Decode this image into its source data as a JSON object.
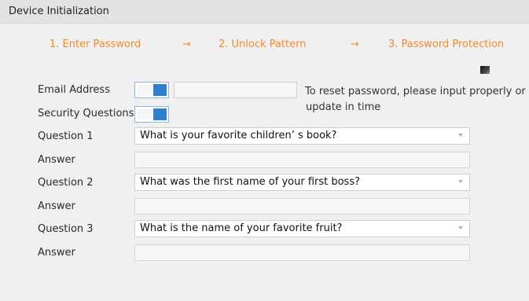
{
  "window": {
    "title": "Device Initialization"
  },
  "steps": [
    {
      "label": "1.  Enter Password"
    },
    {
      "label": "2.  Unlock Pattern"
    },
    {
      "label": "3.  Password Protection"
    }
  ],
  "step_arrow": "→",
  "form": {
    "email": {
      "label": "Email Address",
      "enabled": true,
      "value": "",
      "hint_line1": "To reset password, please input properly or",
      "hint_line2": "update in time"
    },
    "security_questions": {
      "label": "Security Questions",
      "enabled": true
    },
    "questions": [
      {
        "label": "Question 1",
        "selected": "What is your favorite children’ s book?",
        "answer_label": "Answer",
        "answer_value": ""
      },
      {
        "label": "Question 2",
        "selected": "What was the first name of your first boss?",
        "answer_label": "Answer",
        "answer_value": ""
      },
      {
        "label": "Question 3",
        "selected": "What is the name of your favorite fruit?",
        "answer_label": "Answer",
        "answer_value": ""
      }
    ]
  },
  "colors": {
    "step_accent": "#f08a2c",
    "toggle_on": "#2f7fd1"
  }
}
